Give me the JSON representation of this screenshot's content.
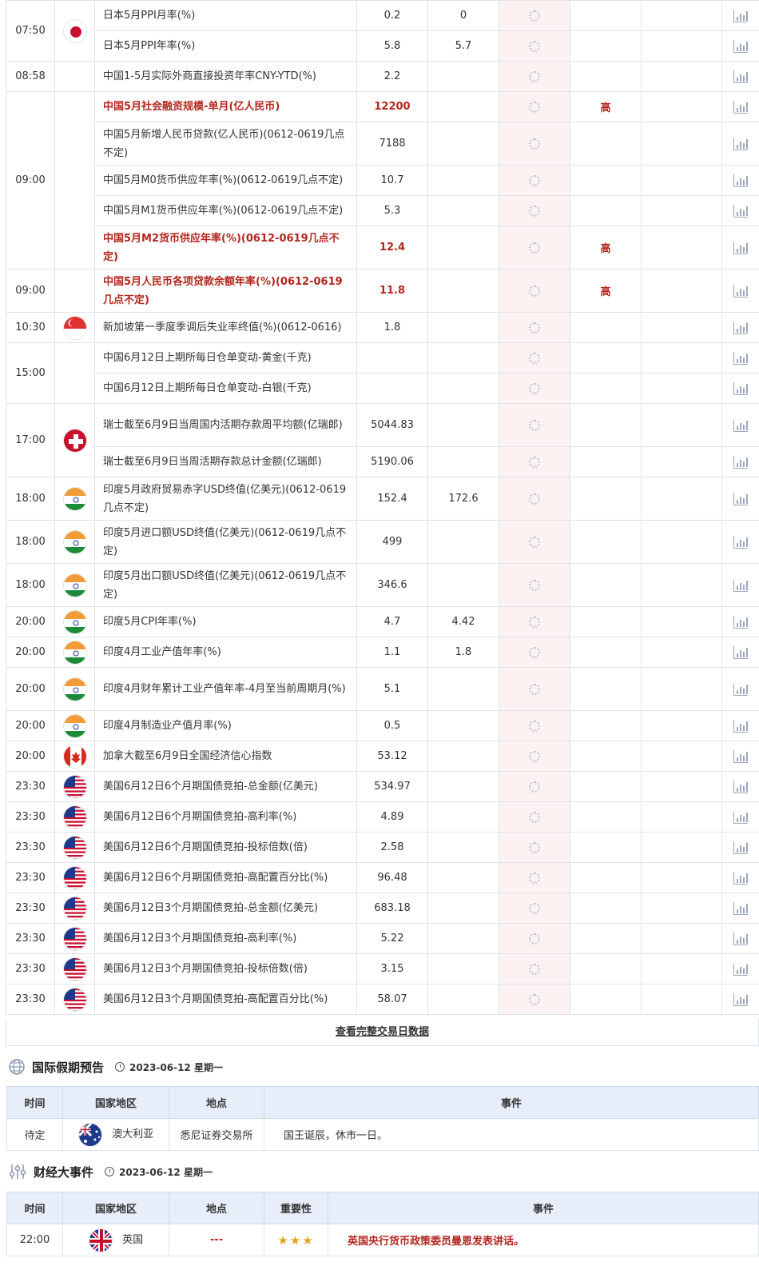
{
  "calendar": {
    "rows": [
      {
        "time": "07:50",
        "flag": "japan",
        "name": "日本5月PPI月率(%)",
        "prev": "0.2",
        "forecast": "0",
        "importance": "",
        "bold": false
      },
      {
        "time": "",
        "flag": "",
        "name": "日本5月PPI年率(%)",
        "prev": "5.8",
        "forecast": "5.7",
        "importance": "",
        "bold": false
      },
      {
        "time": "08:58",
        "flag": "",
        "name": "中国1-5月实际外商直接投资年率CNY-YTD(%)",
        "prev": "2.2",
        "forecast": "",
        "importance": "",
        "bold": false
      },
      {
        "time": "09:00",
        "flag": "",
        "name": "中国5月社会融资规模-单月(亿人民币)",
        "prev": "12200",
        "forecast": "",
        "importance": "高",
        "bold": true
      },
      {
        "time": "",
        "flag": "",
        "name": "中国5月新增人民币贷款(亿人民币)(0612-0619几点不定)",
        "prev": "7188",
        "forecast": "",
        "importance": "",
        "bold": false
      },
      {
        "time": "",
        "flag": "",
        "name": "中国5月M0货币供应年率(%)(0612-0619几点不定)",
        "prev": "10.7",
        "forecast": "",
        "importance": "",
        "bold": false
      },
      {
        "time": "",
        "flag": "",
        "name": "中国5月M1货币供应年率(%)(0612-0619几点不定)",
        "prev": "5.3",
        "forecast": "",
        "importance": "",
        "bold": false
      },
      {
        "time": "",
        "flag": "",
        "name": "中国5月M2货币供应年率(%)(0612-0619几点不定)",
        "prev": "12.4",
        "forecast": "",
        "importance": "高",
        "bold": true
      },
      {
        "time": "09:00",
        "flag": "",
        "name": "中国5月人民币各项贷款余额年率(%)(0612-0619几点不定)",
        "prev": "11.8",
        "forecast": "",
        "importance": "高",
        "bold": true
      },
      {
        "time": "10:30",
        "flag": "singapore",
        "name": "新加坡第一季度季调后失业率终值(%)(0612-0616)",
        "prev": "1.8",
        "forecast": "",
        "importance": "",
        "bold": false
      },
      {
        "time": "15:00",
        "flag": "",
        "name": "中国6月12日上期所每日仓单变动-黄金(千克)",
        "prev": "",
        "forecast": "",
        "importance": "",
        "bold": false
      },
      {
        "time": "",
        "flag": "",
        "name": "中国6月12日上期所每日仓单变动-白银(千克)",
        "prev": "",
        "forecast": "",
        "importance": "",
        "bold": false
      },
      {
        "time": "17:00",
        "flag": "swiss",
        "name": "瑞士截至6月9日当周国内活期存款周平均额(亿瑞郎)",
        "prev": "5044.83",
        "forecast": "",
        "importance": "",
        "bold": false
      },
      {
        "time": "",
        "flag": "",
        "name": "瑞士截至6月9日当周活期存款总计金额(亿瑞郎)",
        "prev": "5190.06",
        "forecast": "",
        "importance": "",
        "bold": false
      },
      {
        "time": "18:00",
        "flag": "india",
        "name": "印度5月政府贸易赤字USD终值(亿美元)(0612-0619几点不定)",
        "prev": "152.4",
        "forecast": "172.6",
        "importance": "",
        "bold": false
      },
      {
        "time": "18:00",
        "flag": "india",
        "name": "印度5月进口额USD终值(亿美元)(0612-0619几点不定)",
        "prev": "499",
        "forecast": "",
        "importance": "",
        "bold": false
      },
      {
        "time": "18:00",
        "flag": "india",
        "name": "印度5月出口额USD终值(亿美元)(0612-0619几点不定)",
        "prev": "346.6",
        "forecast": "",
        "importance": "",
        "bold": false
      },
      {
        "time": "20:00",
        "flag": "india",
        "name": "印度5月CPI年率(%)",
        "prev": "4.7",
        "forecast": "4.42",
        "importance": "",
        "bold": false
      },
      {
        "time": "20:00",
        "flag": "india",
        "name": "印度4月工业产值年率(%)",
        "prev": "1.1",
        "forecast": "1.8",
        "importance": "",
        "bold": false
      },
      {
        "time": "20:00",
        "flag": "india",
        "name": "印度4月财年累计工业产值年率-4月至当前周期月(%)",
        "prev": "5.1",
        "forecast": "",
        "importance": "",
        "bold": false
      },
      {
        "time": "20:00",
        "flag": "india",
        "name": "印度4月制造业产值月率(%)",
        "prev": "0.5",
        "forecast": "",
        "importance": "",
        "bold": false
      },
      {
        "time": "20:00",
        "flag": "canada",
        "name": "加拿大截至6月9日全国经济信心指数",
        "prev": "53.12",
        "forecast": "",
        "importance": "",
        "bold": false
      },
      {
        "time": "23:30",
        "flag": "usa",
        "name": "美国6月12日6个月期国债竞拍-总金额(亿美元)",
        "prev": "534.97",
        "forecast": "",
        "importance": "",
        "bold": false
      },
      {
        "time": "23:30",
        "flag": "usa",
        "name": "美国6月12日6个月期国债竞拍-高利率(%)",
        "prev": "4.89",
        "forecast": "",
        "importance": "",
        "bold": false
      },
      {
        "time": "23:30",
        "flag": "usa",
        "name": "美国6月12日6个月期国债竞拍-投标倍数(倍)",
        "prev": "2.58",
        "forecast": "",
        "importance": "",
        "bold": false
      },
      {
        "time": "23:30",
        "flag": "usa",
        "name": "美国6月12日6个月期国债竞拍-高配置百分比(%)",
        "prev": "96.48",
        "forecast": "",
        "importance": "",
        "bold": false
      },
      {
        "time": "23:30",
        "flag": "usa",
        "name": "美国6月12日3个月期国债竞拍-总金额(亿美元)",
        "prev": "683.18",
        "forecast": "",
        "importance": "",
        "bold": false
      },
      {
        "time": "23:30",
        "flag": "usa",
        "name": "美国6月12日3个月期国债竞拍-高利率(%)",
        "prev": "5.22",
        "forecast": "",
        "importance": "",
        "bold": false
      },
      {
        "time": "23:30",
        "flag": "usa",
        "name": "美国6月12日3个月期国债竞拍-投标倍数(倍)",
        "prev": "3.15",
        "forecast": "",
        "importance": "",
        "bold": false
      },
      {
        "time": "23:30",
        "flag": "usa",
        "name": "美国6月12日3个月期国债竞拍-高配置百分比(%)",
        "prev": "58.07",
        "forecast": "",
        "importance": "",
        "bold": false
      }
    ],
    "more_link": "查看完整交易日数据"
  },
  "holiday": {
    "title": "国际假期预告",
    "date": "2023-06-12 星期一",
    "headers": [
      "时间",
      "国家地区",
      "地点",
      "事件"
    ],
    "row": {
      "time": "待定",
      "country": "澳大利亚",
      "place": "悉尼证券交易所",
      "event": "国王诞辰，休市一日。"
    }
  },
  "events": {
    "title": "财经大事件",
    "date": "2023-06-12 星期一",
    "headers": [
      "时间",
      "国家地区",
      "地点",
      "重要性",
      "事件"
    ],
    "row": {
      "time": "22:00",
      "country": "英国",
      "place": "---",
      "stars": "★★★",
      "event": "英国央行货币政策委员曼恩发表讲话。"
    }
  },
  "colors": {
    "highlight": "#b3261e",
    "header_bg": "#e7eef9",
    "actual_bg": "#fdf2f2"
  }
}
